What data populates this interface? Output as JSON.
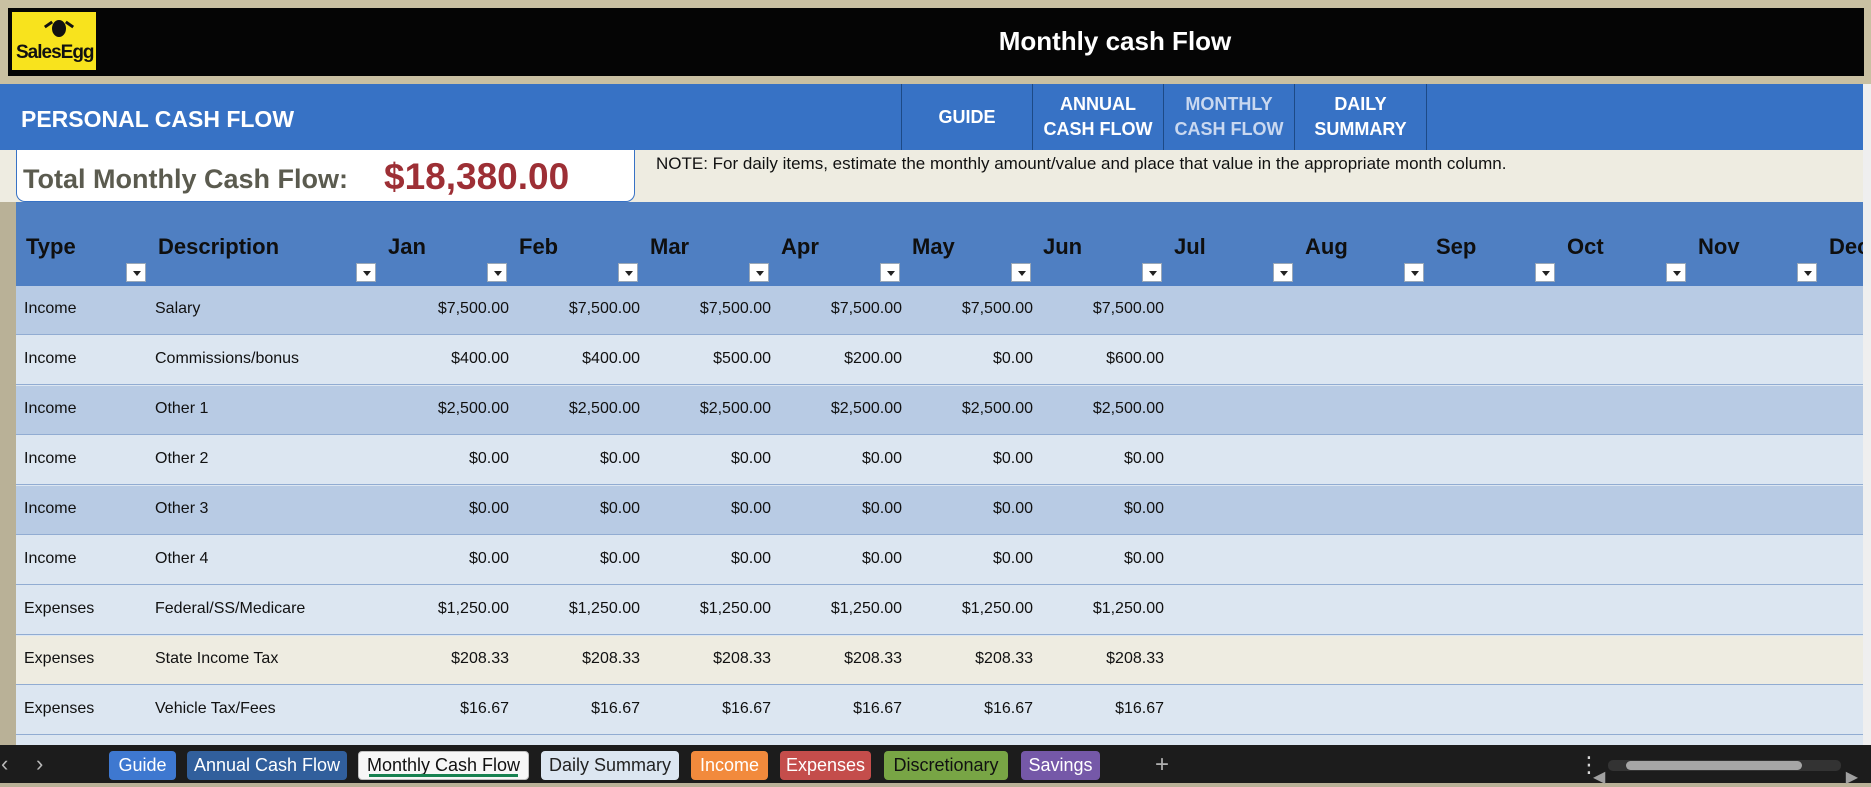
{
  "app": {
    "brand": "SalesEgg",
    "title": "Monthly cash Flow"
  },
  "header": {
    "section_title": "PERSONAL CASH FLOW",
    "tabs": [
      {
        "label": "GUIDE",
        "active": false
      },
      {
        "label": "ANNUAL CASH FLOW",
        "active": false
      },
      {
        "label": "MONTHLY CASH FLOW",
        "active": true
      },
      {
        "label": "DAILY SUMMARY",
        "active": false
      }
    ]
  },
  "summary": {
    "label": "Total Monthly Cash Flow:",
    "value": "$18,380.00",
    "note": "NOTE: For daily items, estimate the monthly amount/value and place that value in the appropriate month column."
  },
  "table": {
    "columns": [
      "Type",
      "Description",
      "Jan",
      "Feb",
      "Mar",
      "Apr",
      "May",
      "Jun",
      "Jul",
      "Aug",
      "Sep",
      "Oct",
      "Nov",
      "Dec"
    ],
    "rows": [
      [
        "Income",
        "Salary",
        "$7,500.00",
        "$7,500.00",
        "$7,500.00",
        "$7,500.00",
        "$7,500.00",
        "$7,500.00",
        "",
        "",
        "",
        "",
        "",
        ""
      ],
      [
        "Income",
        "Commissions/bonus",
        "$400.00",
        "$400.00",
        "$500.00",
        "$200.00",
        "$0.00",
        "$600.00",
        "",
        "",
        "",
        "",
        "",
        ""
      ],
      [
        "Income",
        "Other 1",
        "$2,500.00",
        "$2,500.00",
        "$2,500.00",
        "$2,500.00",
        "$2,500.00",
        "$2,500.00",
        "",
        "",
        "",
        "",
        "",
        ""
      ],
      [
        "Income",
        "Other 2",
        "$0.00",
        "$0.00",
        "$0.00",
        "$0.00",
        "$0.00",
        "$0.00",
        "",
        "",
        "",
        "",
        "",
        ""
      ],
      [
        "Income",
        "Other 3",
        "$0.00",
        "$0.00",
        "$0.00",
        "$0.00",
        "$0.00",
        "$0.00",
        "",
        "",
        "",
        "",
        "",
        ""
      ],
      [
        "Income",
        "Other 4",
        "$0.00",
        "$0.00",
        "$0.00",
        "$0.00",
        "$0.00",
        "$0.00",
        "",
        "",
        "",
        "",
        "",
        ""
      ],
      [
        "Expenses",
        "Federal/SS/Medicare",
        "$1,250.00",
        "$1,250.00",
        "$1,250.00",
        "$1,250.00",
        "$1,250.00",
        "$1,250.00",
        "",
        "",
        "",
        "",
        "",
        ""
      ],
      [
        "Expenses",
        "State Income Tax",
        "$208.33",
        "$208.33",
        "$208.33",
        "$208.33",
        "$208.33",
        "$208.33",
        "",
        "",
        "",
        "",
        "",
        ""
      ],
      [
        "Expenses",
        "Vehicle Tax/Fees",
        "$16.67",
        "$16.67",
        "$16.67",
        "$16.67",
        "$16.67",
        "$16.67",
        "",
        "",
        "",
        "",
        "",
        ""
      ]
    ]
  },
  "sheet_tabs": [
    {
      "label": "Guide",
      "color": "#3e78d0"
    },
    {
      "label": "Annual Cash Flow",
      "color": "#315f9c"
    },
    {
      "label": "Monthly Cash Flow",
      "color": "#f7f7f7",
      "active": true
    },
    {
      "label": "Daily Summary",
      "color": "#dce6f1"
    },
    {
      "label": "Income",
      "color": "#f28a3c"
    },
    {
      "label": "Expenses",
      "color": "#c44d4b"
    },
    {
      "label": "Discretionary",
      "color": "#78a545"
    },
    {
      "label": "Savings",
      "color": "#7558a8"
    }
  ],
  "icons": {
    "logo": "egg-mark-icon",
    "filter": "filter-dropdown-icon",
    "scroll_left": "chevron-left-icon",
    "scroll_right": "chevron-right-icon",
    "add_sheet": "plus-icon",
    "more": "vertical-dots-icon"
  }
}
